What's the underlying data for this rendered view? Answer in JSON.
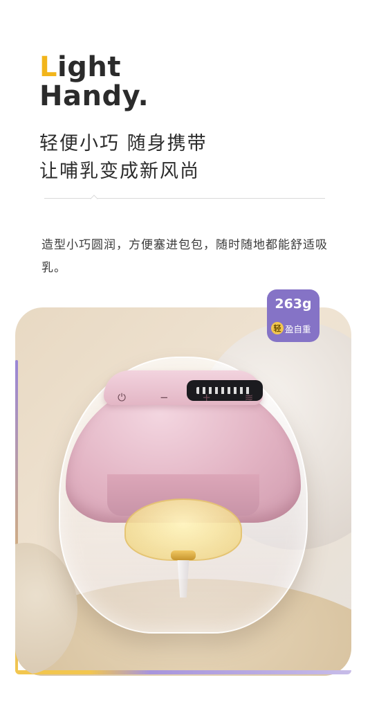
{
  "headline": {
    "accent_letter": "L",
    "line1_rest": "ight",
    "line2": "Handy."
  },
  "subtitle": {
    "line1": "轻便小巧 随身携带",
    "line2": "让哺乳变成新风尚"
  },
  "description": "造型小巧圆润，方便塞进包包，随时随地都能舒适吸乳。",
  "badge": {
    "weight": "263g",
    "light_char": "轻",
    "label": "盈自重"
  },
  "device_buttons": [
    "⏻",
    "−",
    "+",
    "≋"
  ],
  "colors": {
    "accent_yellow": "#f2b51b",
    "badge_purple": "#8573c6",
    "device_pink": "#e2b3c3"
  },
  "icons": {
    "power": "power-icon",
    "minus": "minus-icon",
    "plus": "plus-icon",
    "mode": "mode-icon"
  }
}
